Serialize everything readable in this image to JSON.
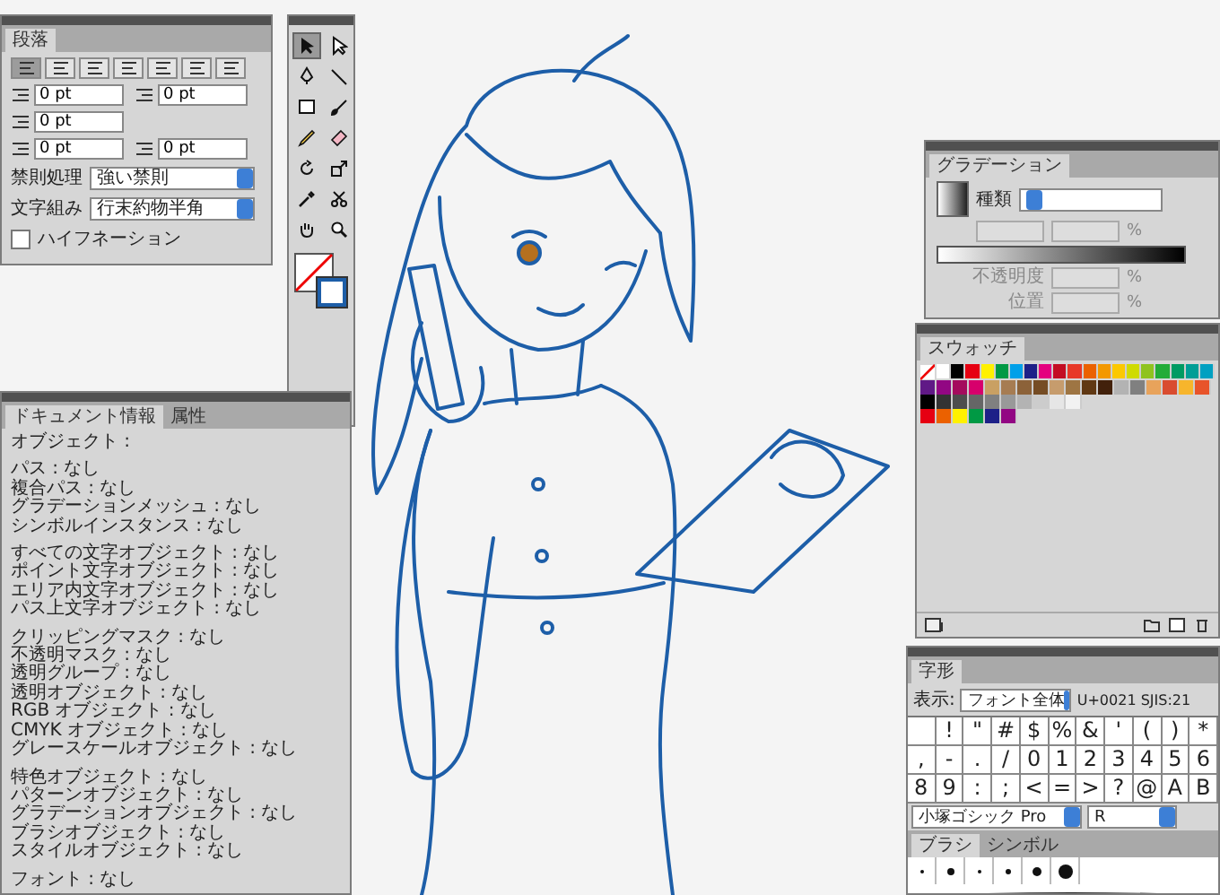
{
  "paragraph_panel": {
    "title": "段落",
    "align_buttons": [
      {
        "selected": true
      },
      {
        "selected": false
      },
      {
        "selected": false
      },
      {
        "selected": false
      },
      {
        "selected": false
      },
      {
        "selected": false
      },
      {
        "selected": false
      }
    ],
    "field_rows": [
      [
        "0 pt",
        "0 pt"
      ],
      [
        "0 pt"
      ],
      [
        "0 pt",
        "0 pt"
      ]
    ],
    "dropdowns": [
      {
        "label": "禁則処理",
        "value": "強い禁則"
      },
      {
        "label": "文字組み",
        "value": "行末約物半角"
      }
    ],
    "hyphenation": {
      "label": "ハイフネーション",
      "checked": false
    }
  },
  "toolbox": {
    "tools": [
      {
        "kind": "arrow",
        "selected": true
      },
      {
        "kind": "hollow-arrow",
        "selected": false
      },
      {
        "kind": "pen",
        "selected": false
      },
      {
        "kind": "line",
        "selected": false
      },
      {
        "kind": "rectangle",
        "selected": false
      },
      {
        "kind": "brush",
        "selected": false
      },
      {
        "kind": "pencil",
        "selected": false
      },
      {
        "kind": "eraser",
        "selected": false
      },
      {
        "kind": "rotate",
        "selected": false
      },
      {
        "kind": "resize",
        "selected": false
      },
      {
        "kind": "eyedropper",
        "selected": false
      },
      {
        "kind": "scissors",
        "selected": false
      },
      {
        "kind": "hand",
        "selected": false
      },
      {
        "kind": "zoom",
        "selected": false
      }
    ]
  },
  "document_info_panel": {
    "tabs": [
      {
        "label": "ドキュメント情報",
        "selected": true
      },
      {
        "label": "属性",
        "selected": false
      }
    ],
    "groups": [
      [
        "オブジェクト :"
      ],
      [
        "パス : なし",
        "複合パス : なし",
        "グラデーションメッシュ : なし",
        "シンボルインスタンス : なし"
      ],
      [
        "すべての文字オブジェクト : なし",
        "ポイント文字オブジェクト : なし",
        "エリア内文字オブジェクト : なし",
        "パス上文字オブジェクト : なし"
      ],
      [
        "クリッピングマスク : なし",
        "不透明マスク : なし",
        "透明グループ : なし",
        "透明オブジェクト : なし",
        "RGB オブジェクト : なし",
        "CMYK オブジェクト : なし",
        "グレースケールオブジェクト : なし"
      ],
      [
        "特色オブジェクト : なし",
        "パターンオブジェクト : なし",
        "グラデーションオブジェクト : なし",
        "ブラシオブジェクト : なし",
        "スタイルオブジェクト : なし"
      ],
      [
        "フォント : なし"
      ]
    ]
  },
  "gradient_panel": {
    "title": "グラデーション",
    "type_label": "種類",
    "ratio_unit": "%",
    "opacity_label": "不透明度",
    "opacity_unit": "%",
    "location_label": "位置",
    "location_unit": "%"
  },
  "swatches_panel": {
    "title": "スウォッチ",
    "rows": [
      [
        {
          "color": "#ffffff"
        },
        {
          "color": "#000000"
        },
        {
          "color": "#e60012"
        },
        {
          "color": "#fff100"
        },
        {
          "color": "#009944"
        },
        {
          "color": "#00a0e9"
        },
        {
          "color": "#1d2088"
        },
        {
          "color": "#e4007f"
        },
        {
          "color": "#c30d23"
        },
        {
          "color": "#e83828"
        },
        {
          "color": "#eb6100"
        },
        {
          "color": "#f39800"
        },
        {
          "color": "#fcc800"
        },
        {
          "color": "#cfdb00"
        },
        {
          "color": "#8fc31f"
        },
        {
          "color": "#22ac38"
        },
        {
          "color": "#009b63"
        },
        {
          "color": "#009e96"
        },
        {
          "color": "#00a0c1"
        }
      ],
      [
        {
          "color": "#601986"
        },
        {
          "color": "#920783"
        },
        {
          "color": "#a40b5d"
        },
        {
          "color": "#d7006c"
        },
        {
          "color": "#c9a063"
        },
        {
          "color": "#a67c52"
        },
        {
          "color": "#8c6239"
        },
        {
          "color": "#754c24"
        },
        {
          "color": "#c69c6d"
        },
        {
          "color": "#9e7543"
        },
        {
          "color": "#603813"
        },
        {
          "color": "#42210b"
        },
        {
          "color": "#b3b3b3"
        },
        {
          "color": "#808080"
        },
        {
          "color": "#e8a35b"
        },
        {
          "color": "#d94c2f"
        },
        {
          "color": "#f7b52c"
        },
        {
          "color": "#e8542a"
        }
      ],
      [
        {
          "color": "#000000"
        },
        {
          "color": "#333333"
        },
        {
          "color": "#4d4d4d"
        },
        {
          "color": "#666666"
        },
        {
          "color": "#808080"
        },
        {
          "color": "#999999"
        },
        {
          "color": "#b3b3b3"
        },
        {
          "color": "#cccccc"
        },
        {
          "color": "#e6e6e6"
        },
        {
          "color": "#f2f2f2"
        }
      ],
      [
        {
          "color": "#e60012"
        },
        {
          "color": "#eb6100"
        },
        {
          "color": "#fff100"
        },
        {
          "color": "#009944"
        },
        {
          "color": "#1d2088"
        },
        {
          "color": "#920783"
        }
      ]
    ]
  },
  "glyphs_panel": {
    "title": "字形",
    "show_label": "表示:",
    "show_value": "フォント全体",
    "code": "U+0021 SJIS:21",
    "rows": [
      [
        {
          "kind": "space"
        },
        {
          "kind": "glyph",
          "char": "!"
        },
        {
          "kind": "glyph",
          "char": "\""
        },
        {
          "kind": "glyph",
          "char": "#"
        },
        {
          "kind": "glyph",
          "char": "$"
        },
        {
          "kind": "glyph",
          "char": "%"
        },
        {
          "kind": "glyph",
          "char": "&"
        },
        {
          "kind": "glyph",
          "char": "'"
        },
        {
          "kind": "glyph",
          "char": "("
        },
        {
          "kind": "glyph",
          "char": ")"
        },
        {
          "kind": "glyph",
          "char": "*"
        }
      ],
      [
        {
          "kind": "glyph",
          "char": ","
        },
        {
          "kind": "glyph",
          "char": "-"
        },
        {
          "kind": "glyph",
          "char": "."
        },
        {
          "kind": "glyph",
          "char": "/"
        },
        {
          "kind": "glyph",
          "char": "0"
        },
        {
          "kind": "glyph",
          "char": "1"
        },
        {
          "kind": "glyph",
          "char": "2"
        },
        {
          "kind": "glyph",
          "char": "3"
        },
        {
          "kind": "glyph",
          "char": "4"
        },
        {
          "kind": "glyph",
          "char": "5"
        },
        {
          "kind": "glyph",
          "char": "6"
        }
      ],
      [
        {
          "kind": "glyph",
          "char": "8"
        },
        {
          "kind": "glyph",
          "char": "9"
        },
        {
          "kind": "glyph",
          "char": ":"
        },
        {
          "kind": "glyph",
          "char": ";"
        },
        {
          "kind": "glyph",
          "char": "<"
        },
        {
          "kind": "glyph",
          "char": "="
        },
        {
          "kind": "glyph",
          "char": ">"
        },
        {
          "kind": "glyph",
          "char": "?"
        },
        {
          "kind": "glyph",
          "char": "@"
        },
        {
          "kind": "glyph",
          "char": "A"
        },
        {
          "kind": "glyph",
          "char": "B"
        }
      ]
    ],
    "font": "小塚ゴシック Pro",
    "style": "R"
  },
  "brushes_panel": {
    "tabs": [
      {
        "label": "ブラシ",
        "selected": true
      },
      {
        "label": "シンボル",
        "selected": false
      }
    ]
  }
}
